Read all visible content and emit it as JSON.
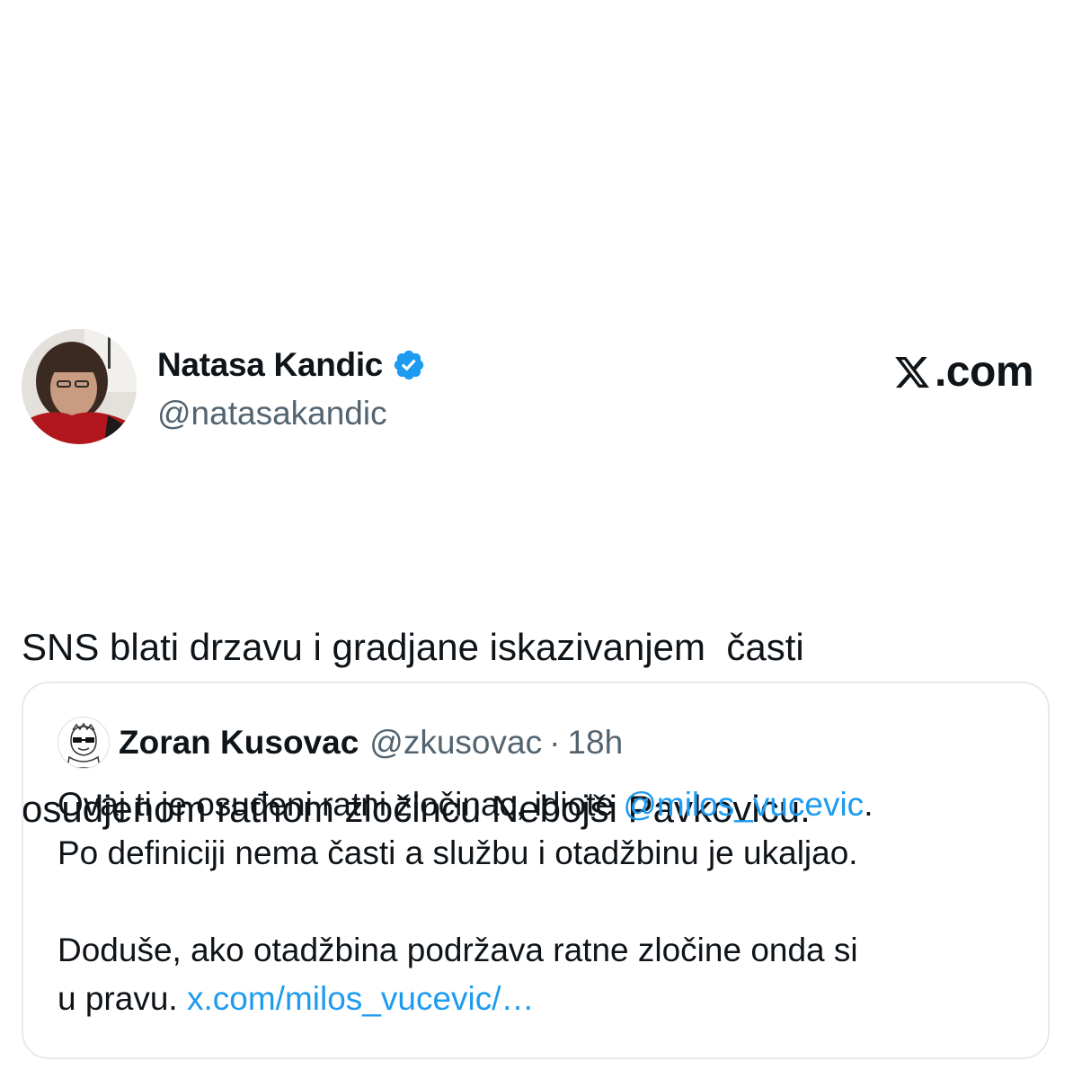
{
  "author": {
    "name": "Natasa Kandic",
    "handle": "@natasakandic",
    "verified": true,
    "avatar_icon": "profile-photo"
  },
  "site_logo": {
    "x_glyph": "𝕏",
    "text": ".com"
  },
  "tweet": {
    "lines": [
      "SNS blati drzavu i gradjane iskazivanjem  časti",
      "osudjenom ratnom zločincu Nebojši Pavkovicu."
    ]
  },
  "quote": {
    "name": "Zoran Kusovac",
    "handle": "@zkusovac",
    "separator": "·",
    "time": "18h",
    "line1_text": "Ovaj ti je osuđeni ratni zločinac, idiote ",
    "line1_mention": "@milos_vucevic",
    "line1_end": ".",
    "line2": "Po definiciji nema časti a službu i otadžbinu je ukaljao.",
    "line3": "Doduše, ako otadžbina podržava ratne zločine onda si",
    "line4_text": "u pravu. ",
    "line4_link": "x.com/milos_vucevic/…"
  },
  "colors": {
    "text": "#0f1419",
    "secondary": "#536471",
    "link": "#1d9bf0",
    "verified": "#1d9bf0",
    "border": "#e6eaed"
  }
}
